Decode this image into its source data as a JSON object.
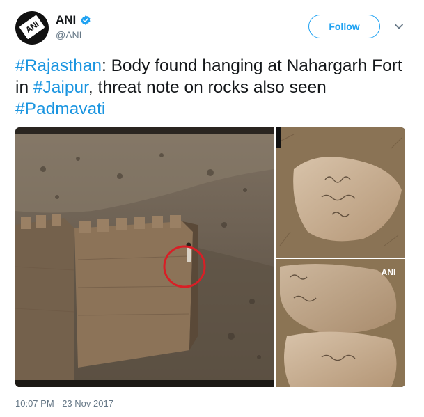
{
  "user": {
    "avatar_text": "ANI",
    "display_name": "ANI",
    "handle": "@ANI",
    "verified": true
  },
  "actions": {
    "follow_label": "Follow",
    "menu_icon": "chevron-down-icon"
  },
  "tweet": {
    "segments": [
      {
        "text": "#Rajasthan",
        "hashtag": true
      },
      {
        "text": ": Body found hanging at Nahargarh Fort in ",
        "hashtag": false
      },
      {
        "text": "#Jaipur",
        "hashtag": true
      },
      {
        "text": ", threat note on rocks also seen ",
        "hashtag": false
      },
      {
        "text": "#Padmavati",
        "hashtag": true
      }
    ],
    "timestamp": "10:07 PM - 23 Nov 2017"
  },
  "media": {
    "watermark": "ANI"
  },
  "colors": {
    "link": "#1b95e0",
    "follow": "#1da1f2",
    "muted": "#657786",
    "highlight_circle": "#d81f26"
  }
}
